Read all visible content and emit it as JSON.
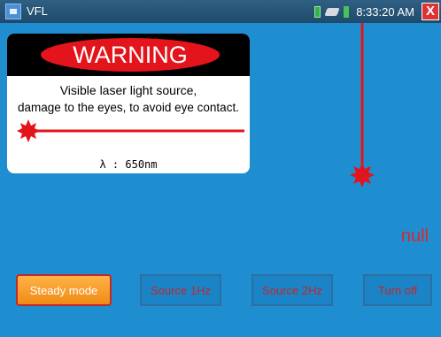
{
  "app": {
    "title": "VFL",
    "clock": "8:33:20 AM",
    "close_label": "X"
  },
  "warning": {
    "heading": "WARNING",
    "line1": "Visible laser light source,",
    "line2": "damage to the eyes, to avoid eye contact.",
    "wavelength": "λ : 650nm"
  },
  "status": {
    "value": "null"
  },
  "buttons": {
    "steady": "Steady mode",
    "btn2": "Source 1Hz",
    "btn3": "Source 2Hz",
    "btn4": "Turn off"
  },
  "colors": {
    "background": "#1f8ed1",
    "laser_red": "#e3141b"
  },
  "icons": [
    "app-icon",
    "battery-icon",
    "usb-icon",
    "signal-icon",
    "close-icon",
    "laser-burst-icon"
  ]
}
